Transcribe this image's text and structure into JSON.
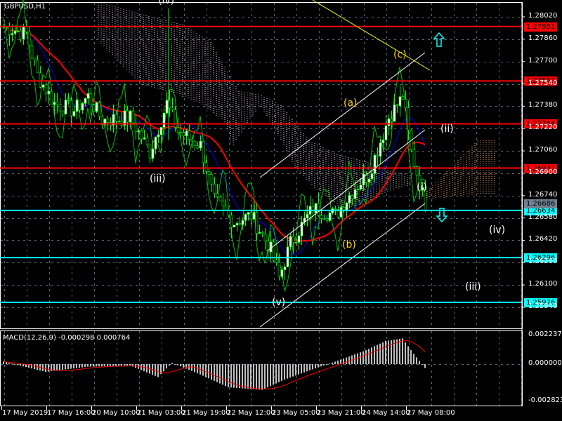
{
  "title": "GBPUSD,H1",
  "macd_label": "MACD(12,26,9) -0.000298 0.000764",
  "colors": {
    "bull": "#00ff00",
    "red_level": "#ff0000",
    "cyan_level": "#00ffff",
    "ma": "#ff0000",
    "ma2": "#0000ff",
    "yellow": "#ffff00",
    "price_tag": "#708090"
  },
  "price_axis": [
    "1.28020",
    "1.27860",
    "1.27700",
    "1.27540",
    "1.27380",
    "1.27220",
    "1.27060",
    "1.26900",
    "1.26740",
    "1.26580",
    "1.26420",
    "1.26260",
    "1.26100",
    "1.25940"
  ],
  "macd_axis": [
    "0.002237",
    "0.000000",
    "-0.002823"
  ],
  "time_axis": [
    "17 May 2019",
    "17 May 16:00",
    "20 May 10:00",
    "21 May 03:00",
    "21 May 19:00",
    "22 May 12:00",
    "23 May 05:00",
    "23 May 21:00",
    "24 May 14:00",
    "27 May 08:00"
  ],
  "levels": [
    {
      "value": "1.27951",
      "kind": "red"
    },
    {
      "value": "1.27561",
      "kind": "red"
    },
    {
      "value": "1.27254",
      "kind": "red"
    },
    {
      "value": "1.26937",
      "kind": "red"
    },
    {
      "value": "1.26634",
      "kind": "cyan"
    },
    {
      "value": "1.26296",
      "kind": "cyan"
    },
    {
      "value": "1.25976",
      "kind": "cyan"
    }
  ],
  "current_price": "1.26686",
  "waves": [
    {
      "text": "(iv)",
      "color": "#ffffff"
    },
    {
      "text": "(iii)",
      "color": "#ffffff"
    },
    {
      "text": "(v)",
      "color": "#ffffff"
    },
    {
      "text": "(a)",
      "color": "#ffd700"
    },
    {
      "text": "(b)",
      "color": "#ffd700"
    },
    {
      "text": "(c)",
      "color": "#ffd700"
    },
    {
      "text": "(ii)",
      "color": "#ffffff"
    },
    {
      "text": "(i)",
      "color": "#ffffff"
    },
    {
      "text": "(iv)",
      "color": "#ffffff"
    },
    {
      "text": "(iii)",
      "color": "#ffffff"
    }
  ],
  "chart_data": {
    "type": "candlestick",
    "symbol": "GBPUSD",
    "timeframe": "H1",
    "ylim": [
      1.258,
      1.2812
    ],
    "price_path": [
      [
        0,
        1.2795
      ],
      [
        8,
        1.279
      ],
      [
        12,
        1.276
      ],
      [
        18,
        1.274
      ],
      [
        25,
        1.2735
      ],
      [
        30,
        1.2745
      ],
      [
        35,
        1.2728
      ],
      [
        45,
        1.273
      ],
      [
        52,
        1.2705
      ],
      [
        58,
        1.274
      ],
      [
        62,
        1.272
      ],
      [
        70,
        1.271
      ],
      [
        75,
        1.267
      ],
      [
        82,
        1.2655
      ],
      [
        88,
        1.266
      ],
      [
        95,
        1.2635
      ],
      [
        98,
        1.2615
      ],
      [
        102,
        1.264
      ],
      [
        110,
        1.2665
      ],
      [
        118,
        1.266
      ],
      [
        125,
        1.268
      ],
      [
        130,
        1.269
      ],
      [
        137,
        1.273
      ],
      [
        142,
        1.2745
      ],
      [
        145,
        1.2705
      ],
      [
        150,
        1.2668
      ]
    ],
    "macd_path": [
      [
        0,
        0.0002
      ],
      [
        15,
        -0.0006
      ],
      [
        30,
        -0.0002
      ],
      [
        45,
        -0.0001
      ],
      [
        55,
        -0.001
      ],
      [
        60,
        0.0001
      ],
      [
        70,
        -0.0008
      ],
      [
        80,
        -0.0018
      ],
      [
        92,
        -0.002
      ],
      [
        100,
        -0.0012
      ],
      [
        110,
        -0.0004
      ],
      [
        118,
        0.0002
      ],
      [
        128,
        0.001
      ],
      [
        136,
        0.0018
      ],
      [
        142,
        0.002
      ],
      [
        146,
        0.0008
      ],
      [
        150,
        -0.0003
      ]
    ],
    "macd_ylim": [
      -0.002823,
      0.002237
    ]
  }
}
